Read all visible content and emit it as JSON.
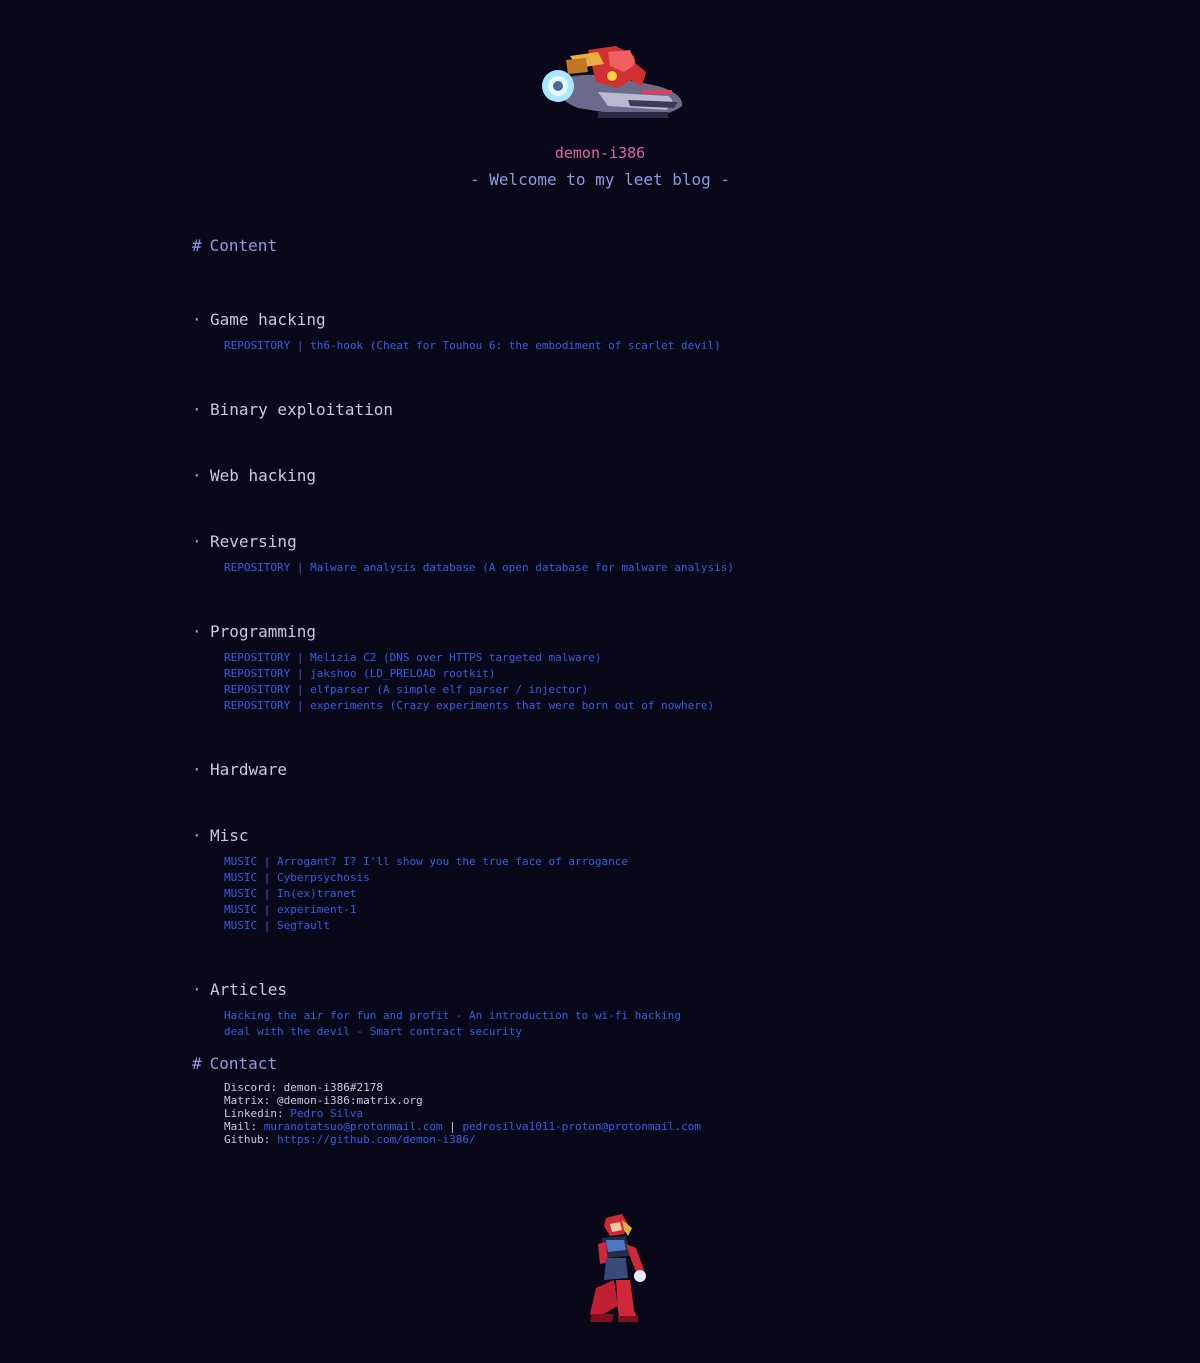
{
  "site": {
    "name": "demon-i386",
    "tagline": "- Welcome to my leet blog -"
  },
  "content_heading": {
    "hash": "#",
    "label": "Content"
  },
  "sections": [
    {
      "bullet": "·",
      "title": "Game hacking",
      "links": [
        {
          "type": "REPOSITORY",
          "sep": " | ",
          "text": "th6-hook (Cheat for Touhou 6: the embodiment of scarlet devil)"
        }
      ]
    },
    {
      "bullet": "·",
      "title": "Binary exploitation",
      "links": []
    },
    {
      "bullet": "·",
      "title": "Web hacking",
      "links": []
    },
    {
      "bullet": "·",
      "title": "Reversing",
      "links": [
        {
          "type": "REPOSITORY",
          "sep": " | ",
          "text": "Malware analysis database (A open database for malware analysis)"
        }
      ]
    },
    {
      "bullet": "·",
      "title": "Programming",
      "links": [
        {
          "type": "REPOSITORY",
          "sep": " | ",
          "text": "Melizia C2 (DNS over HTTPS targeted malware)"
        },
        {
          "type": "REPOSITORY",
          "sep": " | ",
          "text": "jakshoo (LD_PRELOAD rootkit)"
        },
        {
          "type": "REPOSITORY",
          "sep": " | ",
          "text": "elfparser (A simple elf parser / injector)"
        },
        {
          "type": "REPOSITORY",
          "sep": " | ",
          "text": "experiments (Crazy experiments that were born out of nowhere)"
        }
      ]
    },
    {
      "bullet": "·",
      "title": "Hardware",
      "links": []
    },
    {
      "bullet": "·",
      "title": "Misc",
      "links": [
        {
          "type": "MUSIC",
          "sep": " | ",
          "text": "Arrogant? I? I'll show you the true face of arrogance"
        },
        {
          "type": "MUSIC",
          "sep": " | ",
          "text": "Cyberpsychosis"
        },
        {
          "type": "MUSIC",
          "sep": " | ",
          "text": "In(ex)tranet"
        },
        {
          "type": "MUSIC",
          "sep": " | ",
          "text": "experiment-1"
        },
        {
          "type": "MUSIC",
          "sep": " | ",
          "text": "Segfault"
        }
      ]
    },
    {
      "bullet": "·",
      "title": "Articles",
      "links": [
        {
          "type": "",
          "sep": "",
          "text": "Hacking the air for fun and profit - An introduction to wi-fi hacking"
        },
        {
          "type": "",
          "sep": "",
          "text": "deal with the devil - Smart contract security"
        }
      ]
    }
  ],
  "contact_heading": {
    "hash": "#",
    "label": "Contact"
  },
  "contact": {
    "discord": {
      "label": "Discord: ",
      "value": "demon-i386#2178"
    },
    "matrix": {
      "label": "Matrix: ",
      "value": "@demon-i386:matrix.org"
    },
    "linkedin": {
      "label": "Linkedin: ",
      "value": "Pedro Silva"
    },
    "mail": {
      "label": "Mail: ",
      "value1": "muranotatsuo@protonmail.com",
      "sep": " | ",
      "value2": "pedrosilva1011-proton@protonmail.com"
    },
    "github": {
      "label": "Github: ",
      "value": "https://github.com/demon-i386/"
    }
  },
  "colors": {
    "background": "#080818",
    "heading": "#8f98e0",
    "site_name": "#e060b0",
    "link": "#2f5fe6",
    "text": "#c8c8d8"
  },
  "icons": {
    "header_sprite": "ride-chaser-zero-sprite",
    "footer_sprite": "zero-standing-sprite"
  }
}
